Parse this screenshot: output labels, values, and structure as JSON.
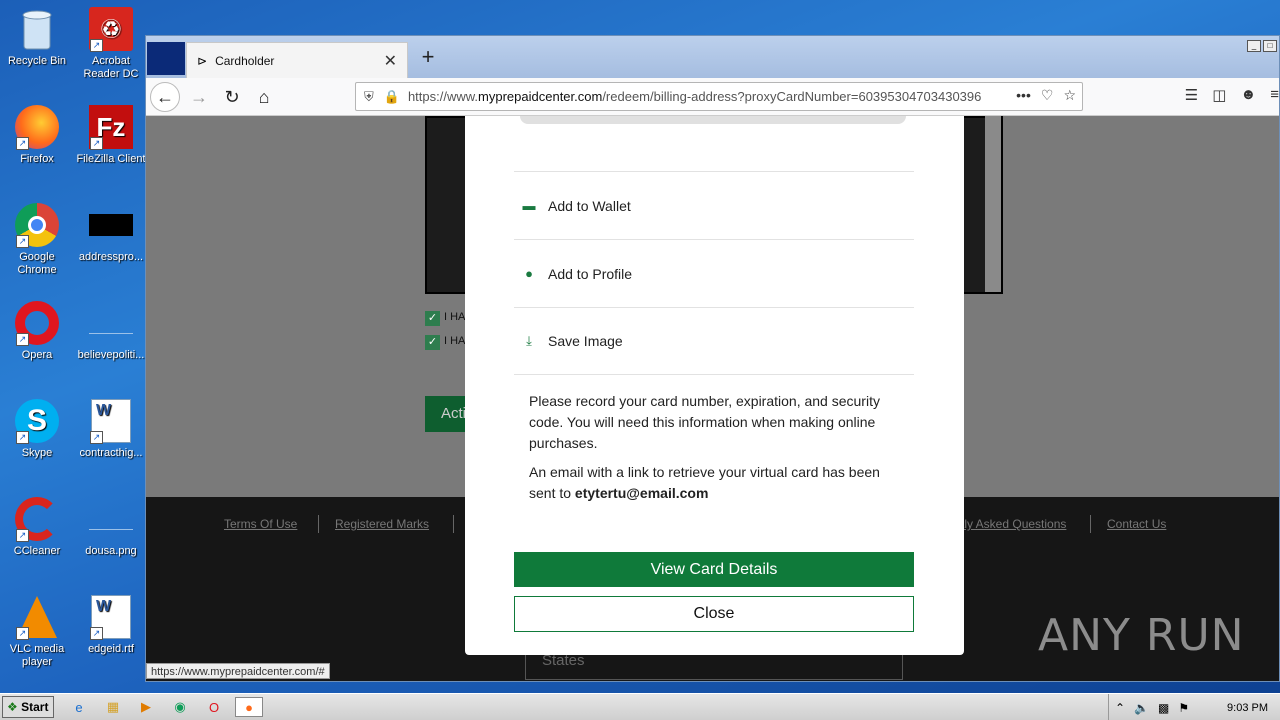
{
  "desktop": {
    "icons": [
      {
        "label": "Recycle Bin"
      },
      {
        "label": "Acrobat Reader DC"
      },
      {
        "label": "Firefox"
      },
      {
        "label": "FileZilla Client"
      },
      {
        "label": "Google Chrome"
      },
      {
        "label": "addresspro..."
      },
      {
        "label": "Opera"
      },
      {
        "label": "believepoliti..."
      },
      {
        "label": "Skype"
      },
      {
        "label": "contracthig..."
      },
      {
        "label": "CCleaner"
      },
      {
        "label": "dousa.png"
      },
      {
        "label": "VLC media player"
      },
      {
        "label": "edgeid.rtf"
      }
    ]
  },
  "browser": {
    "tab_title": "Cardholder",
    "url_prefix": "https://www.",
    "url_domain": "myprepaidcenter.com",
    "url_path": "/redeem/billing-address?proxyCardNumber=60395304703430396",
    "status_url": "https://www.myprepaidcenter.com/#"
  },
  "page": {
    "check1_text": "I HA",
    "check2_text": "I HA",
    "activate_label": "Acti",
    "states_placeholder": "States",
    "footer_links": [
      "Terms Of Use",
      "Registered Marks",
      "tly Asked Questions",
      "Contact Us"
    ]
  },
  "modal": {
    "menu": [
      {
        "label": "Add to Wallet",
        "icon": "wallet-icon"
      },
      {
        "label": "Add to Profile",
        "icon": "user-icon"
      },
      {
        "label": "Save Image",
        "icon": "download-icon"
      }
    ],
    "message1": "Please record your card number, expiration, and security code. You will need this information when making online purchases.",
    "message2_prefix": "An email with a link to retrieve your virtual card has been sent to ",
    "email": "etytertu@email.com",
    "view_details_label": "View Card Details",
    "close_label": "Close"
  },
  "watermark": "ANY RUN",
  "taskbar": {
    "start_label": "Start",
    "clock": "9:03 PM"
  },
  "colors": {
    "accent_green": "#0f7a3a",
    "desktop_blue": "#1c5fb8"
  }
}
